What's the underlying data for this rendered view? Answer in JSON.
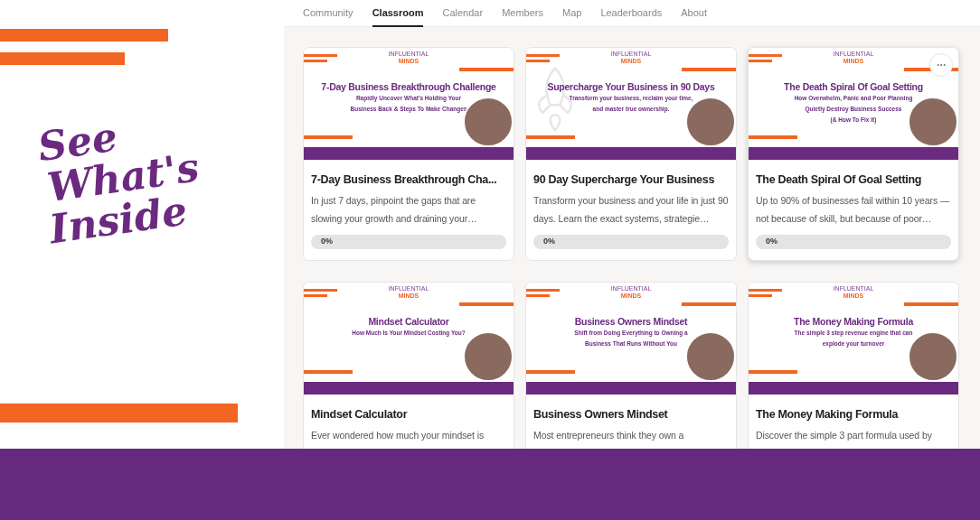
{
  "promo": {
    "headline_lines": [
      "See",
      "What's",
      "Inside"
    ]
  },
  "nav": {
    "tabs": [
      {
        "label": "Community",
        "selected": false
      },
      {
        "label": "Classroom",
        "selected": true
      },
      {
        "label": "Calendar",
        "selected": false
      },
      {
        "label": "Members",
        "selected": false
      },
      {
        "label": "Map",
        "selected": false
      },
      {
        "label": "Leaderboards",
        "selected": false
      },
      {
        "label": "About",
        "selected": false
      }
    ]
  },
  "courses": [
    {
      "cover": {
        "kind": "plain",
        "brand_small": "INFLUENTIAL",
        "brand": "MINDS",
        "title": "7-Day Business Breakthrough Challenge",
        "subtitle_lines": [
          "Rapidly Uncover What's Holding Your",
          "Business Back & Steps To Make Changes"
        ]
      },
      "title": "7-Day Business Breakthrough Cha...",
      "description": "In just 7 days, pinpoint the gaps that are slowing your growth and draining your…",
      "has_menu": false,
      "progress": {
        "label": "0%",
        "level": 0
      }
    },
    {
      "cover": {
        "kind": "rocket",
        "brand_small": "INFLUENTIAL",
        "brand": "MINDS",
        "title": "Supercharge Your Business in 90 Days",
        "subtitle_lines": [
          "Transform your business, reclaim your time,",
          "and master true ownership."
        ]
      },
      "title": "90 Day Supercharge Your Business",
      "description": "Transform your business and your life in just 90 days. Learn the exact systems, strategie…",
      "has_menu": false,
      "progress": {
        "label": "0%",
        "level": 0
      }
    },
    {
      "cover": {
        "kind": "plain",
        "brand_small": "INFLUENTIAL",
        "brand": "MINDS",
        "title": "The Death Spiral Of Goal Setting",
        "subtitle_lines": [
          "How Overwhelm, Panic and Poor Planning",
          "Quietly Destroy Business Success",
          "(& How To Fix It)"
        ]
      },
      "title": "The Death Spiral Of Goal Setting",
      "description": "Up to 90% of businesses fail within 10 years — not because of skill, but because of poor…",
      "has_menu": true,
      "progress": {
        "label": "0%",
        "level": 0
      }
    },
    {
      "cover": {
        "kind": "plain",
        "brand_small": "INFLUENTIAL",
        "brand": "MINDS",
        "title": "Mindset Calculator",
        "subtitle_lines": [
          "How Much Is Your Mindset Costing You?"
        ]
      },
      "title": "Mindset Calculator",
      "description": "Ever wondered how much your mindset is",
      "has_menu": false
    },
    {
      "cover": {
        "kind": "plain",
        "brand_small": "INFLUENTIAL",
        "brand": "MINDS",
        "title": "Business Owners Mindset",
        "subtitle_lines": [
          "Shift from Doing Everything to Owning a",
          "Business That Runs Without You"
        ]
      },
      "title": "Business Owners Mindset",
      "description": "Most entrepreneurs think they own a",
      "has_menu": false
    },
    {
      "cover": {
        "kind": "plain",
        "brand_small": "INFLUENTIAL",
        "brand": "MINDS",
        "title": "The Money Making Formula",
        "subtitle_lines": [
          "The simple 3 step revenue engine that can",
          "explode your turnover"
        ]
      },
      "title": "The Money Making Formula",
      "description": "Discover the simple 3 part formula used by",
      "has_menu": false
    }
  ]
}
